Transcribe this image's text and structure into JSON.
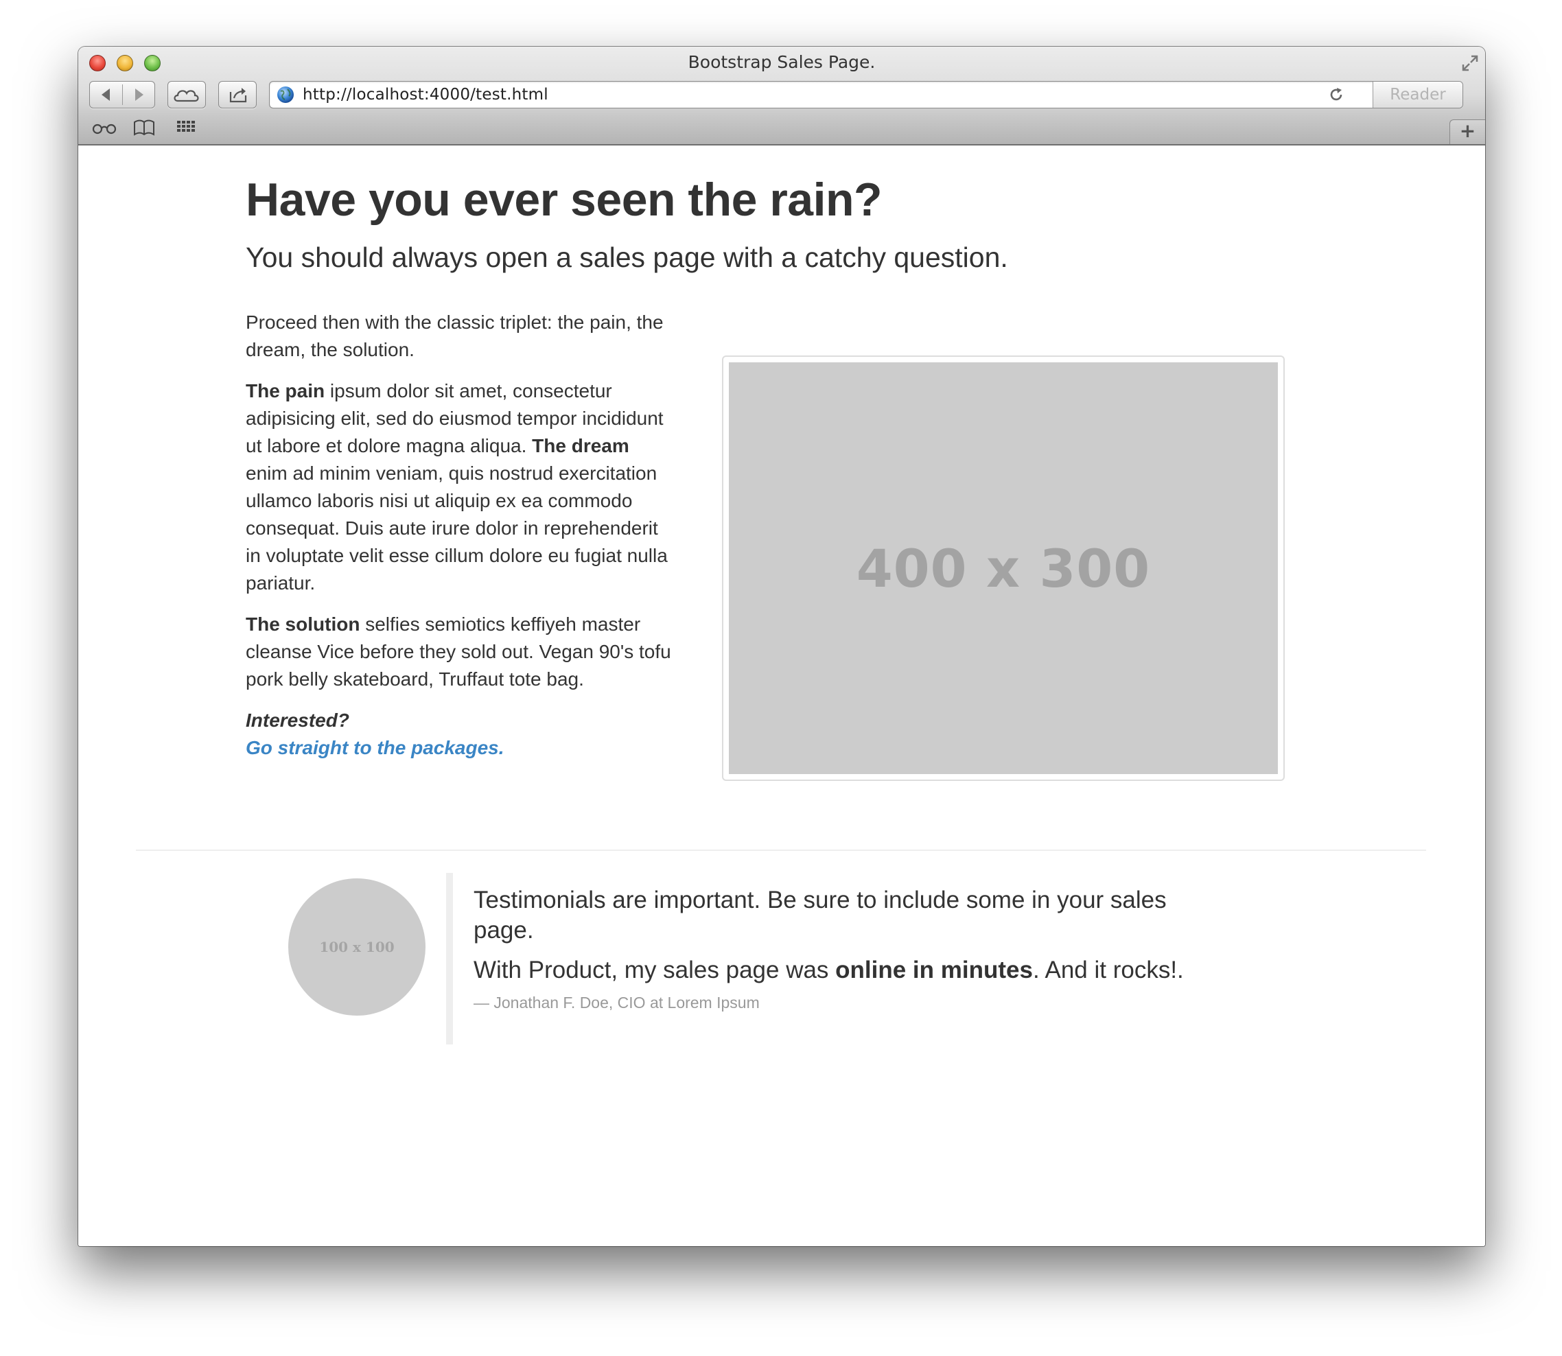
{
  "window": {
    "title": "Bootstrap Sales Page."
  },
  "toolbar": {
    "url": "http://localhost:4000/test.html",
    "reader_label": "Reader",
    "new_tab_label": "+"
  },
  "page": {
    "headline": "Have you ever seen the rain?",
    "subheadline": "You should always open a sales page with a catchy question.",
    "intro": "Proceed then with the classic triplet: the pain, the dream, the solution.",
    "pain_label": "The pain",
    "pain_text": " ipsum dolor sit amet, consectetur adipisicing elit, sed do eiusmod tempor incididunt ut labore et dolore magna aliqua. ",
    "dream_label": "The dream",
    "dream_text": " enim ad minim veniam, quis nostrud exercitation ullamco laboris nisi ut aliquip ex ea commodo consequat. Duis aute irure dolor in reprehenderit in voluptate velit esse cillum dolore eu fugiat nulla pariatur.",
    "solution_label": "The solution",
    "solution_text": " selfies semiotics keffiyeh master cleanse Vice before they sold out. Vegan 90's tofu pork belly skateboard, Truffaut tote bag.",
    "cta_question": "Interested?",
    "cta_link": "Go straight to the packages.",
    "image_placeholder": "400 x 300"
  },
  "testimonial": {
    "avatar_placeholder": "100 x 100",
    "line1": "Testimonials are important. Be sure to include some in your sales page.",
    "line2_before": "With Product, my sales page was ",
    "line2_bold": "online in minutes",
    "line2_after": ". And it rocks!.",
    "attribution": "— Jonathan F. Doe, CIO at Lorem Ipsum"
  },
  "colors": {
    "link": "#3a85c5",
    "text": "#333333",
    "placeholder": "#cccccc"
  }
}
